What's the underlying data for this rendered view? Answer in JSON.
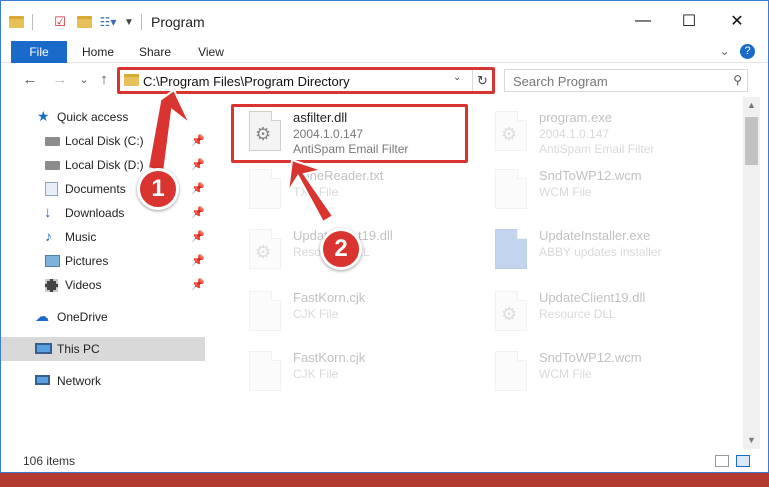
{
  "window": {
    "title": "Program",
    "controls": {
      "minimize": "—",
      "maximize": "☐",
      "close": "✕"
    }
  },
  "ribbon": {
    "tabs": [
      "File",
      "Home",
      "Share",
      "View"
    ],
    "expand": "⌄",
    "help": "?"
  },
  "nav": {
    "back": "←",
    "forward": "→",
    "recent": "⌄",
    "up": "↑",
    "address": "C:\\Program Files\\Program Directory",
    "address_dropdown": "⌄",
    "refresh": "↻",
    "search_placeholder": "Search Program",
    "search_icon": "⚲"
  },
  "sidebar": {
    "items": [
      {
        "label": "Quick access",
        "icon": "star-icon"
      },
      {
        "label": "Local Disk (C:)",
        "icon": "disk-icon",
        "pinned": true
      },
      {
        "label": "Local Disk (D:)",
        "icon": "disk-icon",
        "pinned": true
      },
      {
        "label": "Documents",
        "icon": "documents-icon",
        "pinned": true
      },
      {
        "label": "Downloads",
        "icon": "downloads-icon",
        "pinned": true
      },
      {
        "label": "Music",
        "icon": "music-icon",
        "pinned": true
      },
      {
        "label": "Pictures",
        "icon": "pictures-icon",
        "pinned": true
      },
      {
        "label": "Videos",
        "icon": "videos-icon",
        "pinned": true
      },
      {
        "label": "OneDrive",
        "icon": "cloud-icon"
      },
      {
        "label": "This PC",
        "icon": "computer-icon",
        "selected": true
      },
      {
        "label": "Network",
        "icon": "network-icon"
      }
    ],
    "pin_glyph": "📌"
  },
  "files": [
    {
      "name": "asfilter.dll",
      "line2": "2004.1.0.147",
      "line3": "AntiSpam Email Filter",
      "highlighted": true
    },
    {
      "name": "program.exe",
      "line2": "2004.1.0.147",
      "line3": "AntiSpam Email Filter"
    },
    {
      "name": "NoneReader.txt",
      "line2": "TXT File",
      "line3": ""
    },
    {
      "name": "SndToWP12.wcm",
      "line2": "WCM File",
      "line3": ""
    },
    {
      "name": "UpdateCl...t19.dll",
      "line2": "Resource DLL",
      "line3": ""
    },
    {
      "name": "UpdateInstaller.exe",
      "line2": "ABBY updates installer",
      "line3": ""
    },
    {
      "name": "FastKorn.cjk",
      "line2": "CJK File",
      "line3": ""
    },
    {
      "name": "UpdateClient19.dll",
      "line2": "Resource DLL",
      "line3": ""
    },
    {
      "name": "FastKorn.cjk",
      "line2": "CJK File",
      "line3": ""
    },
    {
      "name": "SndToWP12.wcm",
      "line2": "WCM File",
      "line3": ""
    }
  ],
  "status": {
    "count": "106 items"
  },
  "annotations": {
    "step1": "1",
    "step2": "2",
    "color": "#d9342f"
  }
}
